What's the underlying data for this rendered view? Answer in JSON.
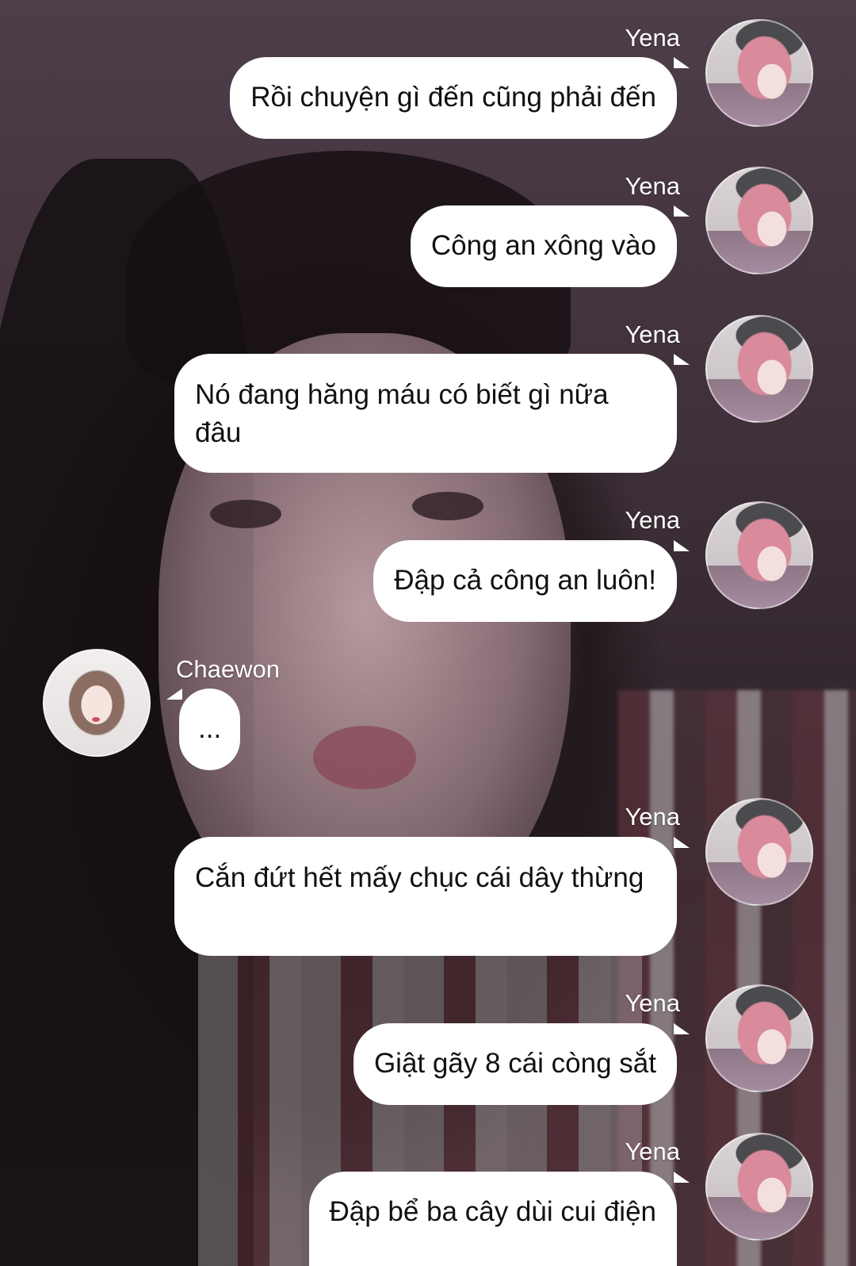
{
  "messages": [
    {
      "sender": "Yena",
      "side": "right",
      "text": "Rồi chuyện gì đến cũng phải đến"
    },
    {
      "sender": "Yena",
      "side": "right",
      "text": "Công an xông vào"
    },
    {
      "sender": "Yena",
      "side": "right",
      "text": "Nó đang hăng máu có biết gì nữa đâu"
    },
    {
      "sender": "Yena",
      "side": "right",
      "text": "Đập cả công an luôn!"
    },
    {
      "sender": "Chaewon",
      "side": "left",
      "text": "..."
    },
    {
      "sender": "Yena",
      "side": "right",
      "text": "Cắn đứt hết mấy chục cái dây thừng"
    },
    {
      "sender": "Yena",
      "side": "right",
      "text": "Giật gãy 8 cái còng sắt"
    },
    {
      "sender": "Yena",
      "side": "right",
      "text": "Đập bể ba cây dùi cui điện"
    }
  ],
  "colors": {
    "bubble": "#ffffff",
    "background": "#3a2e36",
    "name_text": "#ffffff"
  }
}
